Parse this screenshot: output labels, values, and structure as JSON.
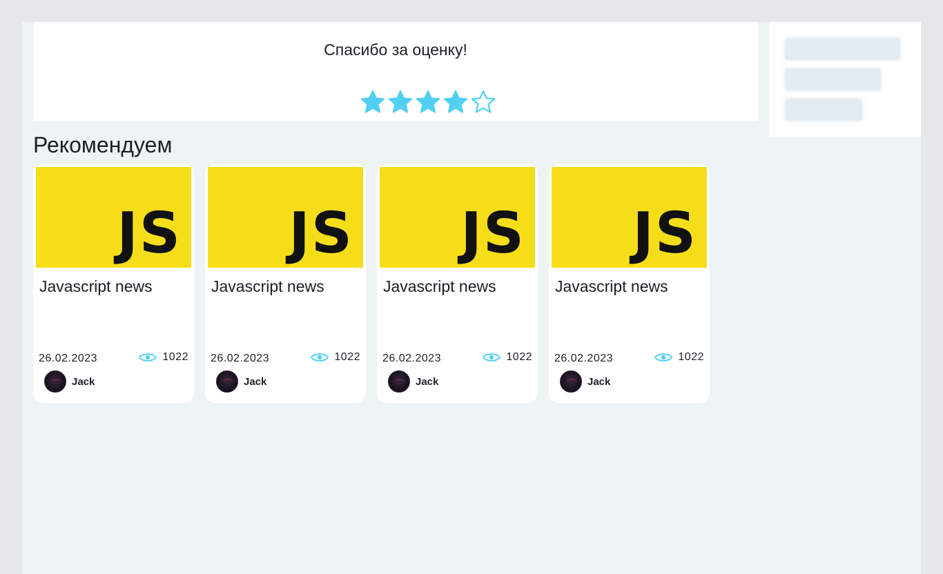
{
  "rating": {
    "message": "Спасибо за оценку!",
    "value": 4,
    "max": 5,
    "star_color": "#52d0f2"
  },
  "sidebar": {
    "skeleton_items": 3
  },
  "recommended": {
    "title": "Рекомендуем",
    "cards": [
      {
        "logo_text": "JS",
        "title": "Javascript news",
        "date": "26.02.2023",
        "views": "1022",
        "author": "Jack"
      },
      {
        "logo_text": "JS",
        "title": "Javascript news",
        "date": "26.02.2023",
        "views": "1022",
        "author": "Jack"
      },
      {
        "logo_text": "JS",
        "title": "Javascript news",
        "date": "26.02.2023",
        "views": "1022",
        "author": "Jack"
      },
      {
        "logo_text": "JS",
        "title": "Javascript news",
        "date": "26.02.2023",
        "views": "1022",
        "author": "Jack"
      }
    ]
  },
  "colors": {
    "accent": "#52d0f2",
    "js_yellow": "#f5de19",
    "page_bg": "#eef3f6",
    "skeleton": "#e2ebf0"
  },
  "icons": {
    "star_filled": "star-filled-icon",
    "star_empty": "star-outline-icon",
    "views": "eye-icon"
  }
}
